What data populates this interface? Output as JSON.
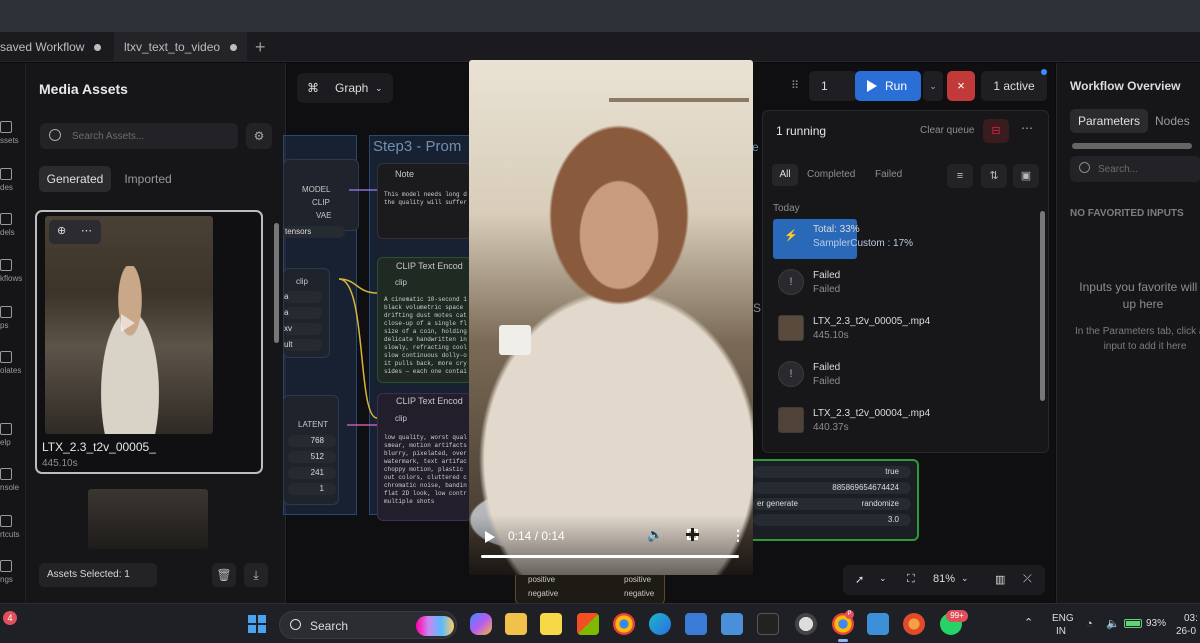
{
  "tabs": [
    {
      "label": "saved Workflow"
    },
    {
      "label": "ltxv_text_to_video"
    }
  ],
  "tab_add": "+",
  "rail": {
    "items": [
      "ssets",
      "des",
      "dels",
      "kflows",
      "ps",
      "olates",
      "elp",
      "nsole",
      "rtcuts",
      "ngs"
    ]
  },
  "assets": {
    "title": "Media Assets",
    "search_placeholder": "Search Assets...",
    "tab_generated": "Generated",
    "tab_imported": "Imported",
    "card": {
      "name": "LTX_2.3_t2v_00005_",
      "duration": "445.10s"
    },
    "footer": "Assets Selected: 1"
  },
  "canvas": {
    "graph_label": "Graph",
    "group_title": "Step3 - Prom",
    "note_title": "Note",
    "note_text": "This model needs long d\nthe quality will suffer",
    "clip_node_1": "CLIP Text Encod",
    "clip_node_2": "CLIP Text Encod",
    "slot_clip": "clip",
    "prompt_positive": "A cinematic 10-second 1\nblack volumetric space\ndrifting dust motes cat\nclose-up of a single fl\nsize of a coin, holding\ndelicate handwritten in\nslowly, refracting cool\nslow continuous dolly-o\nit pulls back, more cry\nsides — each one contai",
    "prompt_negative": "low quality, worst qual\nsmear, motion artifacts\nblurry, pixelated, over\nwatermark, text artifac\nchoppy motion, plastic\nout colors, cluttered c\nchromatic noise, bandin\nflat 2D look, low contr\nmultiple shots",
    "loader_slots": [
      "MODEL",
      "CLIP",
      "VAE"
    ],
    "tensors_label": "tensors",
    "latent_label": "LATENT",
    "latent_values": [
      "768",
      "512",
      "241",
      "1"
    ],
    "left_widgets": [
      "a",
      "a",
      "xv",
      "ult"
    ],
    "sampler_widgets": [
      {
        "label": "",
        "value": "true"
      },
      {
        "label": "",
        "value": "885869654674424"
      },
      {
        "label": "er generate",
        "value": "randomize"
      },
      {
        "label": "",
        "value": "3.0"
      }
    ],
    "cond_slots": [
      "positive",
      "negative"
    ],
    "cond_outputs": [
      "positive",
      "negative"
    ],
    "side_letters": [
      "e",
      "S"
    ]
  },
  "run": {
    "count": "1",
    "run_label": "Run",
    "stop_icon": "×",
    "active_label": "1 active"
  },
  "queue": {
    "title": "1 running",
    "clear_label": "Clear queue",
    "filters": [
      "All",
      "Completed",
      "Failed"
    ],
    "today": "Today",
    "items": [
      {
        "title": "Total: 33%",
        "sub": "SamplerCustom : 17%",
        "progress": 0.33
      },
      {
        "title": "Failed",
        "sub": "Failed"
      },
      {
        "title": "LTX_2.3_t2v_00005_.mp4",
        "sub": "445.10s"
      },
      {
        "title": "Failed",
        "sub": "Failed"
      },
      {
        "title": "LTX_2.3_t2v_00004_.mp4",
        "sub": "440.37s"
      }
    ]
  },
  "zoom": {
    "level": "81%"
  },
  "overview": {
    "title": "Workflow Overview",
    "tab_parameters": "Parameters",
    "tab_nodes": "Nodes",
    "search_placeholder": "Search...",
    "no_favorites": "NO FAVORITED INPUTS",
    "fav_hint": "Inputs you favorite will s up here",
    "fav_help": "In the Parameters tab, click any input to add it here"
  },
  "video": {
    "time": "0:14 / 0:14",
    "progress": 1.0
  },
  "taskbar": {
    "badge": "4",
    "search": "Search",
    "whatsapp_badge": "99+",
    "chrome_badge": "P",
    "lang1": "ENG",
    "lang2": "IN",
    "battery": "93%",
    "time": "03:",
    "date": "26-0"
  },
  "colors": {
    "accent": "#2a6fd6",
    "stop": "#c2393a",
    "progress": "#2a69b8",
    "group": "#244a74"
  }
}
